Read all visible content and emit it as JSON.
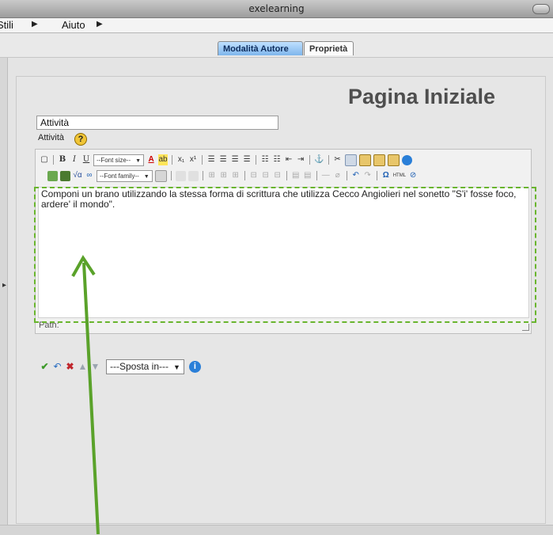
{
  "window": {
    "title": "exelearning"
  },
  "menu": {
    "items": [
      "Stili",
      "Aiuto"
    ]
  },
  "tabs": [
    {
      "label": "Modalità Autore",
      "active": true
    },
    {
      "label": "Proprietà",
      "active": false
    }
  ],
  "page": {
    "title": "Pagina Iniziale"
  },
  "idevice": {
    "title_value": "Attività",
    "label": "Attività",
    "help_icon": "help-icon",
    "editor": {
      "font_size_placeholder": "--Font size--",
      "font_family_placeholder": "--Font family--",
      "content": "Componi un brano utilizzando la stessa forma di scrittura che utilizza Cecco Angiolieri nel sonetto \"S'i' fosse foco, ardere' il mondo\".",
      "path_label": "Path:"
    },
    "actions": {
      "move_select_value": "---Sposta in---"
    }
  },
  "colors": {
    "highlight": "#69b52e",
    "active_tab": "#7fb6ec",
    "arrow": "#5aa22a"
  }
}
